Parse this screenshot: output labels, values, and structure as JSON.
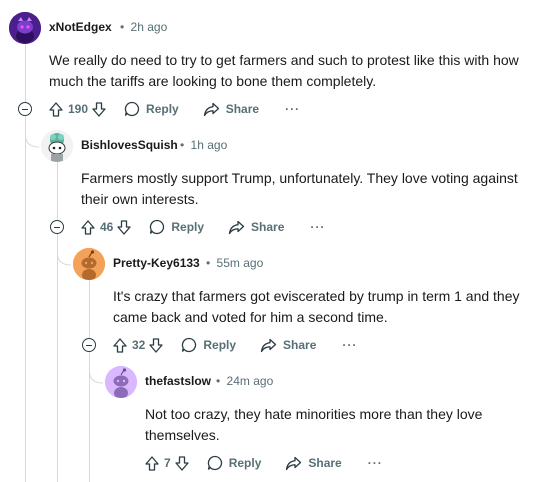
{
  "comments": [
    {
      "author": "xNotEdgex",
      "time": "2h ago",
      "body": "We really do need to try to get farmers and such to protest like this with how much the tariffs are looking to bone them completely.",
      "votes": "190",
      "reply_label": "Reply",
      "share_label": "Share",
      "more_label": "···"
    },
    {
      "author": "BishlovesSquish",
      "time": "1h ago",
      "body": "Farmers mostly support Trump, unfortunately. They love voting against their own interests.",
      "votes": "46",
      "reply_label": "Reply",
      "share_label": "Share",
      "more_label": "···"
    },
    {
      "author": "Pretty-Key6133",
      "time": "55m ago",
      "body": "It's crazy that farmers got eviscerated by trump in term 1 and they came back and voted for him a second time.",
      "votes": "32",
      "reply_label": "Reply",
      "share_label": "Share",
      "more_label": "···"
    },
    {
      "author": "thefastslow",
      "time": "24m ago",
      "body": "Not too crazy, they hate minorities more than they love themselves.",
      "votes": "7",
      "reply_label": "Reply",
      "share_label": "Share",
      "more_label": "···"
    }
  ],
  "separator": "•",
  "colors": {
    "meta": "#576f76",
    "thread_line": "#d6dadc",
    "avatar_1_bg": "#4b1f8c",
    "avatar_2_bg": "#e8e8e8",
    "avatar_3_bg": "#f4a259",
    "avatar_4_bg": "#d9b8ff"
  }
}
